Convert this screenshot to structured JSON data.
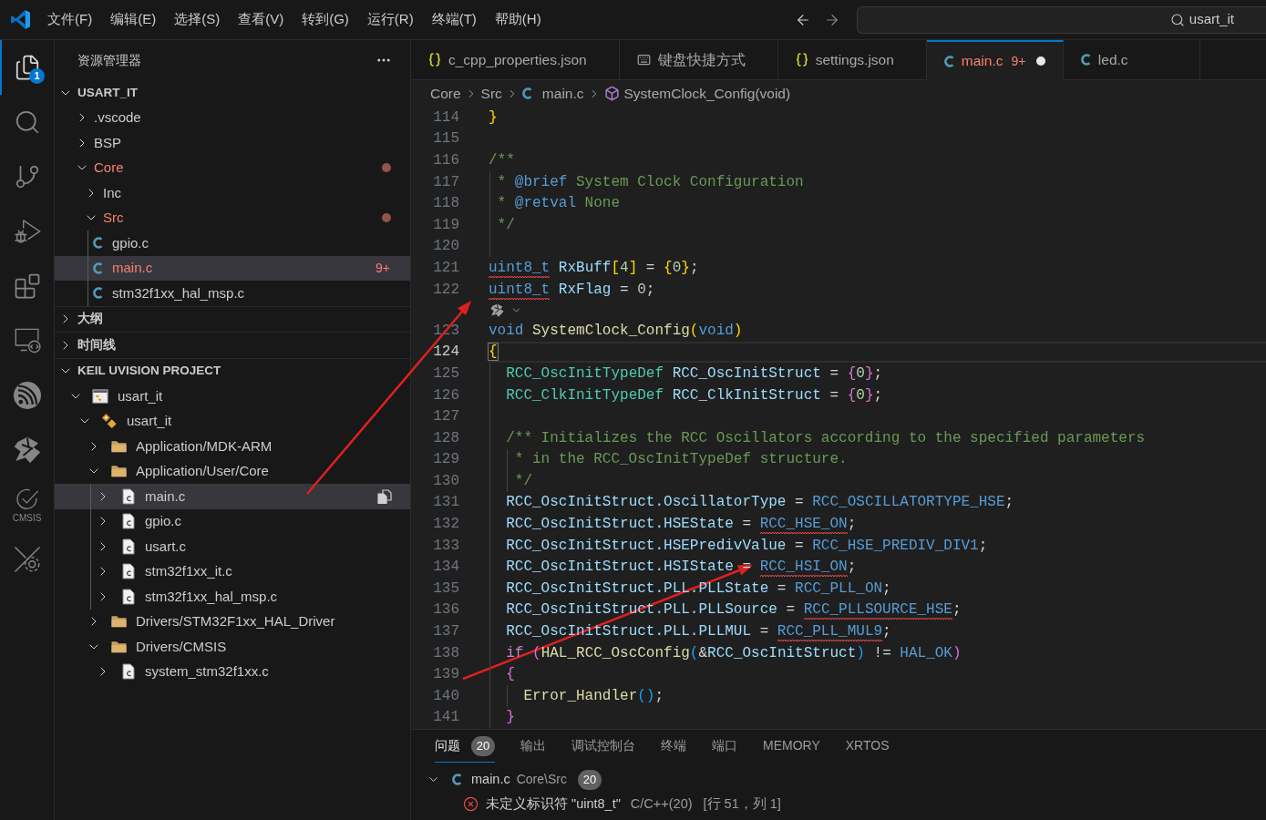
{
  "title_bar": {
    "menu": [
      "文件(F)",
      "编辑(E)",
      "选择(S)",
      "查看(V)",
      "转到(G)",
      "运行(R)",
      "终端(T)",
      "帮助(H)"
    ],
    "command_center": "usart_it"
  },
  "activity_bar": [
    {
      "kind": "explorer",
      "selected": true,
      "badge": "1"
    },
    {
      "kind": "search",
      "selected": false
    },
    {
      "kind": "source-control",
      "selected": false
    },
    {
      "kind": "run-debug",
      "selected": false
    },
    {
      "kind": "extensions",
      "selected": false
    },
    {
      "kind": "remote",
      "selected": false
    },
    {
      "kind": "espressif",
      "selected": false
    },
    {
      "kind": "stm32",
      "selected": false
    },
    {
      "kind": "cmsis",
      "selected": false,
      "label": "CMSIS"
    },
    {
      "kind": "device-settings",
      "selected": false
    }
  ],
  "sidebar": {
    "title": "资源管理器",
    "sections": [
      {
        "title": "USART_IT",
        "expanded": true,
        "items": [
          {
            "name": ".vscode",
            "kind": "folder",
            "expanded": false,
            "selected": false,
            "has_errors": false
          },
          {
            "name": "BSP",
            "kind": "folder",
            "expanded": false,
            "selected": false,
            "has_errors": false
          },
          {
            "name": "Core",
            "kind": "folder",
            "expanded": true,
            "selected": false,
            "has_errors": true,
            "children": [
              {
                "name": "Inc",
                "kind": "folder",
                "expanded": false,
                "selected": false,
                "has_errors": false
              },
              {
                "name": "Src",
                "kind": "folder",
                "expanded": true,
                "selected": false,
                "has_errors": true,
                "children": [
                  {
                    "name": "gpio.c",
                    "kind": "c-file",
                    "selected": false,
                    "has_errors": false
                  },
                  {
                    "name": "main.c",
                    "kind": "c-file",
                    "selected": true,
                    "has_errors": true,
                    "badge": "9+"
                  },
                  {
                    "name": "stm32f1xx_hal_msp.c",
                    "kind": "c-file",
                    "selected": false,
                    "has_errors": false
                  }
                ]
              }
            ]
          }
        ]
      },
      {
        "title": "大纲",
        "expanded": false
      },
      {
        "title": "时间线",
        "expanded": false
      },
      {
        "title": "KEIL UVISION PROJECT",
        "expanded": true,
        "items": [
          {
            "name": "usart_it",
            "kind": "project",
            "expanded": true,
            "selected": false,
            "children": [
              {
                "name": "usart_it",
                "kind": "target",
                "expanded": true,
                "selected": false,
                "children": [
                  {
                    "name": "Application/MDK-ARM",
                    "kind": "group",
                    "expanded": false,
                    "selected": false
                  },
                  {
                    "name": "Application/User/Core",
                    "kind": "group",
                    "expanded": true,
                    "selected": false,
                    "children": [
                      {
                        "name": "main.c",
                        "kind": "source",
                        "expanded": false,
                        "selected": true
                      },
                      {
                        "name": "gpio.c",
                        "kind": "source",
                        "expanded": false,
                        "selected": false
                      },
                      {
                        "name": "usart.c",
                        "kind": "source",
                        "expanded": false,
                        "selected": false
                      },
                      {
                        "name": "stm32f1xx_it.c",
                        "kind": "source",
                        "expanded": false,
                        "selected": false
                      },
                      {
                        "name": "stm32f1xx_hal_msp.c",
                        "kind": "source",
                        "expanded": false,
                        "selected": false
                      }
                    ]
                  },
                  {
                    "name": "Drivers/STM32F1xx_HAL_Driver",
                    "kind": "group",
                    "expanded": false,
                    "selected": false
                  },
                  {
                    "name": "Drivers/CMSIS",
                    "kind": "group",
                    "expanded": true,
                    "selected": false,
                    "children": [
                      {
                        "name": "system_stm32f1xx.c",
                        "kind": "source",
                        "expanded": false,
                        "selected": false
                      }
                    ]
                  }
                ]
              }
            ]
          }
        ]
      }
    ]
  },
  "editor": {
    "tabs": [
      {
        "label": "c_cpp_properties.json",
        "kind": "json",
        "selected": false,
        "has_errors": false,
        "modified": false
      },
      {
        "label": "键盘快捷方式",
        "kind": "keyboard",
        "selected": false,
        "has_errors": false,
        "modified": false
      },
      {
        "label": "settings.json",
        "kind": "json",
        "selected": false,
        "has_errors": false,
        "modified": false
      },
      {
        "label": "main.c",
        "kind": "c",
        "selected": true,
        "has_errors": true,
        "badge": "9+",
        "modified": true
      },
      {
        "label": "led.c",
        "kind": "c",
        "selected": false,
        "has_errors": false,
        "modified": false
      }
    ],
    "breadcrumb": [
      {
        "label": "Core",
        "kind": "folder"
      },
      {
        "label": "Src",
        "kind": "folder"
      },
      {
        "label": "main.c",
        "kind": "c-file"
      },
      {
        "label": "SystemClock_Config(void)",
        "kind": "method"
      }
    ],
    "code": {
      "lines": [
        {
          "kind": "code",
          "number": "114",
          "current": false,
          "tokens": [
            {
              "text": "}",
              "kind": "bracket1",
              "error": false
            }
          ]
        },
        {
          "kind": "code",
          "number": "115",
          "current": false
        },
        {
          "kind": "code",
          "number": "116",
          "current": false,
          "tokens": [
            {
              "text": "/**",
              "kind": "comment",
              "error": false
            }
          ]
        },
        {
          "kind": "code",
          "number": "117",
          "current": false,
          "tokens": [
            {
              "text": " * ",
              "kind": "comment",
              "error": false
            },
            {
              "text": "@brief",
              "kind": "doc-tag",
              "error": false
            },
            {
              "text": " System Clock Configuration",
              "kind": "comment",
              "error": false
            }
          ]
        },
        {
          "kind": "code",
          "number": "118",
          "current": false,
          "tokens": [
            {
              "text": " * ",
              "kind": "comment",
              "error": false
            },
            {
              "text": "@retval",
              "kind": "doc-tag",
              "error": false
            },
            {
              "text": " None",
              "kind": "comment",
              "error": false
            }
          ]
        },
        {
          "kind": "code",
          "number": "119",
          "current": false,
          "tokens": [
            {
              "text": " */",
              "kind": "comment",
              "error": false
            }
          ]
        },
        {
          "kind": "code",
          "number": "120",
          "current": false
        },
        {
          "kind": "code",
          "number": "121",
          "current": false,
          "tokens": [
            {
              "text": "uint8_t",
              "kind": "keyword",
              "error": true
            },
            {
              "text": " RxBuff",
              "kind": "variable",
              "error": false
            },
            {
              "text": "[",
              "kind": "bracket1",
              "error": false
            },
            {
              "text": "4",
              "kind": "number",
              "error": false
            },
            {
              "text": "]",
              "kind": "bracket1",
              "error": false
            },
            {
              "text": " = ",
              "kind": "plain",
              "error": false
            },
            {
              "text": "{",
              "kind": "bracket1",
              "error": false
            },
            {
              "text": "0",
              "kind": "number",
              "error": false
            },
            {
              "text": "}",
              "kind": "bracket1",
              "error": false
            },
            {
              "text": ";",
              "kind": "plain",
              "error": false
            }
          ]
        },
        {
          "kind": "code",
          "number": "122",
          "current": false,
          "tokens": [
            {
              "text": "uint8_t",
              "kind": "keyword",
              "error": true
            },
            {
              "text": " RxFlag",
              "kind": "variable",
              "error": false
            },
            {
              "text": " = ",
              "kind": "plain",
              "error": false
            },
            {
              "text": "0",
              "kind": "number",
              "error": false
            },
            {
              "text": ";",
              "kind": "plain",
              "error": false
            }
          ]
        },
        {
          "kind": "codelens"
        },
        {
          "kind": "code",
          "number": "123",
          "current": false,
          "tokens": [
            {
              "text": "void ",
              "kind": "keyword",
              "error": false
            },
            {
              "text": "SystemClock_Config",
              "kind": "function",
              "error": false
            },
            {
              "text": "(",
              "kind": "bracket1",
              "error": false
            },
            {
              "text": "void",
              "kind": "keyword",
              "error": false
            },
            {
              "text": ")",
              "kind": "bracket1",
              "error": false
            }
          ]
        },
        {
          "kind": "code",
          "number": "124",
          "current": true,
          "tokens": [
            {
              "text": "{",
              "kind": "bracket1",
              "error": false
            }
          ]
        },
        {
          "kind": "code",
          "number": "125",
          "current": false,
          "tokens": [
            {
              "text": "  RCC_OscInitTypeDef",
              "kind": "type",
              "error": false
            },
            {
              "text": " RCC_OscInitStruct",
              "kind": "variable",
              "error": false
            },
            {
              "text": " = ",
              "kind": "plain",
              "error": false
            },
            {
              "text": "{",
              "kind": "bracket2",
              "error": false
            },
            {
              "text": "0",
              "kind": "number",
              "error": false
            },
            {
              "text": "}",
              "kind": "bracket2",
              "error": false
            },
            {
              "text": ";",
              "kind": "plain",
              "error": false
            }
          ]
        },
        {
          "kind": "code",
          "number": "126",
          "current": false,
          "tokens": [
            {
              "text": "  RCC_ClkInitTypeDef",
              "kind": "type",
              "error": false
            },
            {
              "text": " RCC_ClkInitStruct",
              "kind": "variable",
              "error": false
            },
            {
              "text": " = ",
              "kind": "plain",
              "error": false
            },
            {
              "text": "{",
              "kind": "bracket2",
              "error": false
            },
            {
              "text": "0",
              "kind": "number",
              "error": false
            },
            {
              "text": "}",
              "kind": "bracket2",
              "error": false
            },
            {
              "text": ";",
              "kind": "plain",
              "error": false
            }
          ]
        },
        {
          "kind": "code",
          "number": "127",
          "current": false
        },
        {
          "kind": "code",
          "number": "128",
          "current": false,
          "tokens": [
            {
              "text": "  /** Initializes the RCC Oscillators according to the specified parameters",
              "kind": "comment",
              "error": false
            }
          ]
        },
        {
          "kind": "code",
          "number": "129",
          "current": false,
          "tokens": [
            {
              "text": "   * in the RCC_OscInitTypeDef structure.",
              "kind": "comment",
              "error": false
            }
          ]
        },
        {
          "kind": "code",
          "number": "130",
          "current": false,
          "tokens": [
            {
              "text": "   */",
              "kind": "comment",
              "error": false
            }
          ]
        },
        {
          "kind": "code",
          "number": "131",
          "current": false,
          "tokens": [
            {
              "text": "  RCC_OscInitStruct.OscillatorType",
              "kind": "variable",
              "error": false
            },
            {
              "text": " = ",
              "kind": "plain",
              "error": false
            },
            {
              "text": "RCC_OSCILLATORTYPE_HSE",
              "kind": "macro",
              "error": false
            },
            {
              "text": ";",
              "kind": "plain",
              "error": false
            }
          ]
        },
        {
          "kind": "code",
          "number": "132",
          "current": false,
          "tokens": [
            {
              "text": "  RCC_OscInitStruct.HSEState",
              "kind": "variable",
              "error": false
            },
            {
              "text": " = ",
              "kind": "plain",
              "error": false
            },
            {
              "text": "RCC_HSE_ON",
              "kind": "macro",
              "error": true
            },
            {
              "text": ";",
              "kind": "plain",
              "error": false
            }
          ]
        },
        {
          "kind": "code",
          "number": "133",
          "current": false,
          "tokens": [
            {
              "text": "  RCC_OscInitStruct.HSEPredivValue",
              "kind": "variable",
              "error": false
            },
            {
              "text": " = ",
              "kind": "plain",
              "error": false
            },
            {
              "text": "RCC_HSE_PREDIV_DIV1",
              "kind": "macro",
              "error": false
            },
            {
              "text": ";",
              "kind": "plain",
              "error": false
            }
          ]
        },
        {
          "kind": "code",
          "number": "134",
          "current": false,
          "tokens": [
            {
              "text": "  RCC_OscInitStruct.HSIState",
              "kind": "variable",
              "error": false
            },
            {
              "text": " = ",
              "kind": "plain",
              "error": false
            },
            {
              "text": "RCC_HSI_ON",
              "kind": "macro",
              "error": true
            },
            {
              "text": ";",
              "kind": "plain",
              "error": false
            }
          ]
        },
        {
          "kind": "code",
          "number": "135",
          "current": false,
          "tokens": [
            {
              "text": "  RCC_OscInitStruct.PLL.PLLState",
              "kind": "variable",
              "error": false
            },
            {
              "text": " = ",
              "kind": "plain",
              "error": false
            },
            {
              "text": "RCC_PLL_ON",
              "kind": "macro",
              "error": false
            },
            {
              "text": ";",
              "kind": "plain",
              "error": false
            }
          ]
        },
        {
          "kind": "code",
          "number": "136",
          "current": false,
          "tokens": [
            {
              "text": "  RCC_OscInitStruct.PLL.PLLSource",
              "kind": "variable",
              "error": false
            },
            {
              "text": " = ",
              "kind": "plain",
              "error": false
            },
            {
              "text": "RCC_PLLSOURCE_HSE",
              "kind": "macro",
              "error": true
            },
            {
              "text": ";",
              "kind": "plain",
              "error": false
            }
          ]
        },
        {
          "kind": "code",
          "number": "137",
          "current": false,
          "tokens": [
            {
              "text": "  RCC_OscInitStruct.PLL.PLLMUL",
              "kind": "variable",
              "error": false
            },
            {
              "text": " = ",
              "kind": "plain",
              "error": false
            },
            {
              "text": "RCC_PLL_MUL9",
              "kind": "macro",
              "error": true
            },
            {
              "text": ";",
              "kind": "plain",
              "error": false
            }
          ]
        },
        {
          "kind": "code",
          "number": "138",
          "current": false,
          "tokens": [
            {
              "text": "  if ",
              "kind": "control",
              "error": false
            },
            {
              "text": "(",
              "kind": "bracket2",
              "error": false
            },
            {
              "text": "HAL_RCC_OscConfig",
              "kind": "function",
              "error": false
            },
            {
              "text": "(",
              "kind": "bracket3",
              "error": false
            },
            {
              "text": "&",
              "kind": "plain",
              "error": false
            },
            {
              "text": "RCC_OscInitStruct",
              "kind": "variable",
              "error": false
            },
            {
              "text": ")",
              "kind": "bracket3",
              "error": false
            },
            {
              "text": " != ",
              "kind": "plain",
              "error": false
            },
            {
              "text": "HAL_OK",
              "kind": "macro",
              "error": false
            },
            {
              "text": ")",
              "kind": "bracket2",
              "error": false
            }
          ]
        },
        {
          "kind": "code",
          "number": "139",
          "current": false,
          "tokens": [
            {
              "text": "  {",
              "kind": "bracket2",
              "error": false
            }
          ]
        },
        {
          "kind": "code",
          "number": "140",
          "current": false,
          "tokens": [
            {
              "text": "    Error_Handler",
              "kind": "function",
              "error": false
            },
            {
              "text": "(",
              "kind": "bracket3",
              "error": false
            },
            {
              "text": ")",
              "kind": "bracket3",
              "error": false
            },
            {
              "text": ";",
              "kind": "plain",
              "error": false
            }
          ]
        },
        {
          "kind": "code",
          "number": "141",
          "current": false,
          "tokens": [
            {
              "text": "  }",
              "kind": "bracket2",
              "error": false
            }
          ]
        }
      ]
    }
  },
  "panel": {
    "tabs": [
      {
        "label": "问题",
        "selected": true,
        "badge": "20"
      },
      {
        "label": "输出",
        "selected": false
      },
      {
        "label": "调试控制台",
        "selected": false
      },
      {
        "label": "终端",
        "selected": false
      },
      {
        "label": "端口",
        "selected": false
      },
      {
        "label": "MEMORY",
        "selected": false
      },
      {
        "label": "XRTOS",
        "selected": false
      }
    ],
    "problems": [
      {
        "file": "main.c",
        "path": "Core\\Src",
        "count": "20",
        "expanded": true,
        "items": [
          {
            "kind": "error",
            "message": "未定义标识符 \"uint8_t\"",
            "source": "C/C++(20)",
            "location": "[行 51，列 1]"
          }
        ]
      }
    ]
  }
}
